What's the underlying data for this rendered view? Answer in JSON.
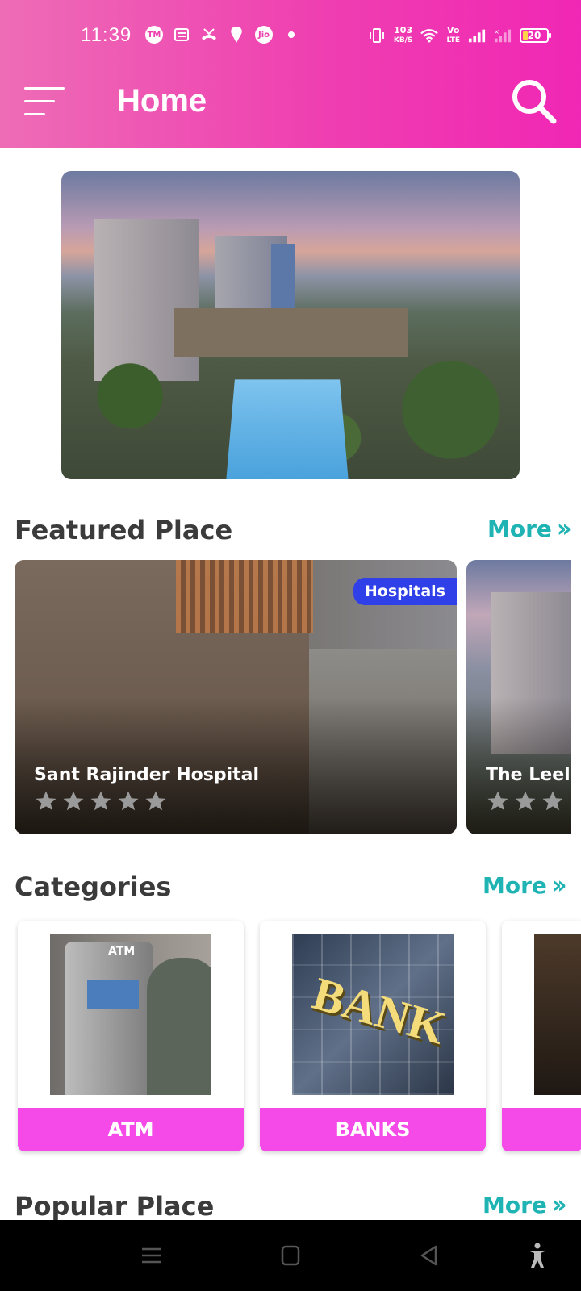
{
  "status_bar": {
    "time": "11:39",
    "net_speed_value": "103",
    "net_speed_unit": "KB/S",
    "volte_top": "Vo",
    "volte_bottom": "LTE",
    "battery": "20",
    "jio_label": "Jio",
    "icons": [
      "tm-icon",
      "news-icon",
      "missed-call-icon",
      "swiggy-icon",
      "jio-icon",
      "dot-icon",
      "vibrate-icon",
      "wifi-icon",
      "signal-icon",
      "signal-x-icon",
      "battery-icon"
    ]
  },
  "header": {
    "title": "Home",
    "menu_icon": "menu-icon",
    "search_icon": "search-icon",
    "background_start": "#ee6cb6",
    "background_end": "#f027b4"
  },
  "featured": {
    "title": "Featured Place",
    "more_label": "More",
    "cards": [
      {
        "name": "Sant Rajinder Hospital",
        "badge": "Hospitals",
        "rating": 0
      },
      {
        "name": "The Leela",
        "rating": 0
      }
    ]
  },
  "categories": {
    "title": "Categories",
    "more_label": "More",
    "items": [
      {
        "label": "ATM",
        "image_text": "ATM"
      },
      {
        "label": "BANKS",
        "image_text": "BANK"
      }
    ]
  },
  "popular": {
    "title": "Popular Place",
    "more_label": "More"
  },
  "colors": {
    "accent_teal": "#1fb3b3",
    "category_pink": "#f54ae8",
    "badge_blue": "#2f40e8"
  },
  "nav": {
    "icons": [
      "recent-apps-icon",
      "home-nav-icon",
      "back-icon",
      "accessibility-icon"
    ]
  }
}
